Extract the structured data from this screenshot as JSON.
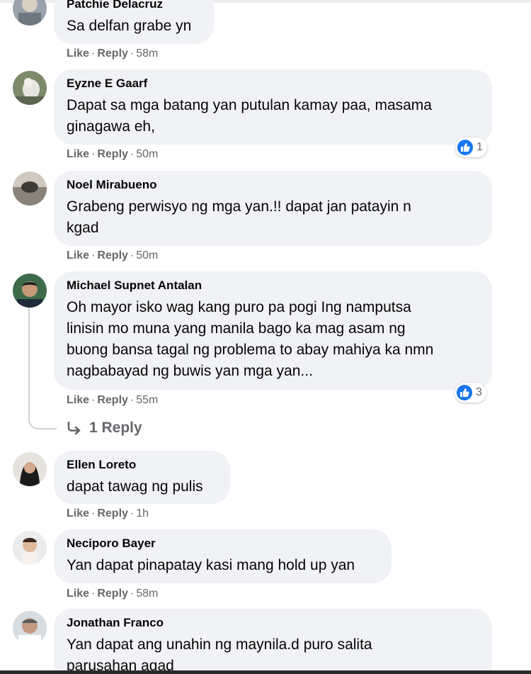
{
  "comments": [
    {
      "name": "Patchie Delacruz",
      "lines": [
        "Sa delfan grabe yn"
      ],
      "like": "Like",
      "reply": "Reply",
      "time": "58m"
    },
    {
      "name": "Eyzne E Gaarf",
      "lines": [
        "Dapat sa mga batang yan putulan kamay paa, masama",
        "ginagawa eh,"
      ],
      "like": "Like",
      "reply": "Reply",
      "time": "50m",
      "reactions": "1"
    },
    {
      "name": "Noel Mirabueno",
      "lines": [
        "Grabeng perwisyo ng mga yan.!! dapat jan patayin n",
        "kgad"
      ],
      "like": "Like",
      "reply": "Reply",
      "time": "50m"
    },
    {
      "name": "Michael Supnet Antalan",
      "lines": [
        "Oh mayor isko wag kang puro pa pogi Ing namputsa",
        "linisin mo muna yang manila bago ka mag asam ng",
        "buong bansa tagal ng problema to abay mahiya ka nmn",
        "nagbabayad ng buwis yan mga yan..."
      ],
      "like": "Like",
      "reply": "Reply",
      "time": "55m",
      "reactions": "3",
      "replies_label": "1 Reply"
    },
    {
      "name": "Ellen Loreto",
      "lines": [
        "dapat tawag ng pulis"
      ],
      "like": "Like",
      "reply": "Reply",
      "time": "1h"
    },
    {
      "name": "Neciporo Bayer",
      "lines": [
        "Yan dapat pinapatay kasi mang hold up yan"
      ],
      "like": "Like",
      "reply": "Reply",
      "time": "58m"
    },
    {
      "name": "Jonathan Franco",
      "lines": [
        "Yan dapat ang unahin ng maynila.d puro salita",
        "parusahan agad"
      ]
    }
  ],
  "separator": "·",
  "icons": {
    "reaction": "like-reaction-icon",
    "reply_arrow": "reply-arrow-icon"
  },
  "colors": {
    "bubble": "#f0f2f5",
    "meta": "#65676b",
    "like_blue": "#1877f2"
  }
}
